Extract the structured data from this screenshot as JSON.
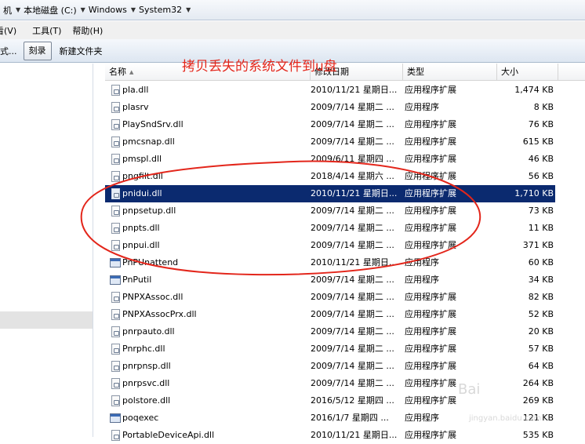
{
  "address": {
    "crumbs": [
      "机",
      "本地磁盘 (C:)",
      "Windows",
      "System32"
    ]
  },
  "menubar": {
    "items": [
      "看(V)",
      "工具(T)",
      "帮助(H)"
    ]
  },
  "toolbar": {
    "partial": "式...",
    "burn": "刻录",
    "new_folder": "新建文件夹"
  },
  "annotation": {
    "text": "拷贝丢失的系统文件到u盘",
    "color": "#e3261b"
  },
  "columns": {
    "name": "名称",
    "date": "修改日期",
    "type": "类型",
    "size": "大小"
  },
  "files": [
    {
      "name": "pla.dll",
      "date": "2010/11/21 星期日...",
      "type": "应用程序扩展",
      "size": "1,474 KB",
      "icon": "dll-file-icon"
    },
    {
      "name": "plasrv",
      "date": "2009/7/14 星期二 ...",
      "type": "应用程序",
      "size": "8 KB",
      "icon": "dll-file-icon"
    },
    {
      "name": "PlaySndSrv.dll",
      "date": "2009/7/14 星期二 ...",
      "type": "应用程序扩展",
      "size": "76 KB",
      "icon": "dll-file-icon"
    },
    {
      "name": "pmcsnap.dll",
      "date": "2009/7/14 星期二 ...",
      "type": "应用程序扩展",
      "size": "615 KB",
      "icon": "dll-file-icon"
    },
    {
      "name": "pmspl.dll",
      "date": "2009/6/11 星期四 ...",
      "type": "应用程序扩展",
      "size": "46 KB",
      "icon": "dll-file-icon"
    },
    {
      "name": "pngfilt.dll",
      "date": "2018/4/14 星期六 ...",
      "type": "应用程序扩展",
      "size": "56 KB",
      "icon": "dll-file-icon"
    },
    {
      "name": "pnidui.dll",
      "date": "2010/11/21 星期日...",
      "type": "应用程序扩展",
      "size": "1,710 KB",
      "icon": "dll-file-icon",
      "selected": true
    },
    {
      "name": "pnpsetup.dll",
      "date": "2009/7/14 星期二 ...",
      "type": "应用程序扩展",
      "size": "73 KB",
      "icon": "dll-file-icon"
    },
    {
      "name": "pnpts.dll",
      "date": "2009/7/14 星期二 ...",
      "type": "应用程序扩展",
      "size": "11 KB",
      "icon": "dll-file-icon"
    },
    {
      "name": "pnpui.dll",
      "date": "2009/7/14 星期二 ...",
      "type": "应用程序扩展",
      "size": "371 KB",
      "icon": "dll-file-icon"
    },
    {
      "name": "PnPUnattend",
      "date": "2010/11/21 星期日...",
      "type": "应用程序",
      "size": "60 KB",
      "icon": "exe-file-icon"
    },
    {
      "name": "PnPutil",
      "date": "2009/7/14 星期二 ...",
      "type": "应用程序",
      "size": "34 KB",
      "icon": "exe-file-icon"
    },
    {
      "name": "PNPXAssoc.dll",
      "date": "2009/7/14 星期二 ...",
      "type": "应用程序扩展",
      "size": "82 KB",
      "icon": "dll-file-icon"
    },
    {
      "name": "PNPXAssocPrx.dll",
      "date": "2009/7/14 星期二 ...",
      "type": "应用程序扩展",
      "size": "52 KB",
      "icon": "dll-file-icon"
    },
    {
      "name": "pnrpauto.dll",
      "date": "2009/7/14 星期二 ...",
      "type": "应用程序扩展",
      "size": "20 KB",
      "icon": "dll-file-icon"
    },
    {
      "name": "Pnrphc.dll",
      "date": "2009/7/14 星期二 ...",
      "type": "应用程序扩展",
      "size": "57 KB",
      "icon": "dll-file-icon"
    },
    {
      "name": "pnrpnsp.dll",
      "date": "2009/7/14 星期二 ...",
      "type": "应用程序扩展",
      "size": "64 KB",
      "icon": "dll-file-icon"
    },
    {
      "name": "pnrpsvc.dll",
      "date": "2009/7/14 星期二 ...",
      "type": "应用程序扩展",
      "size": "264 KB",
      "icon": "dll-file-icon"
    },
    {
      "name": "polstore.dll",
      "date": "2016/5/12 星期四 ...",
      "type": "应用程序扩展",
      "size": "269 KB",
      "icon": "dll-file-icon"
    },
    {
      "name": "poqexec",
      "date": "2016/1/7 星期四 ...",
      "type": "应用程序",
      "size": "121 KB",
      "icon": "exe-file-icon"
    },
    {
      "name": "PortableDeviceApi.dll",
      "date": "2010/11/21 星期日...",
      "type": "应用程序扩展",
      "size": "535 KB",
      "icon": "dll-file-icon"
    }
  ],
  "watermark": {
    "text": "Bai",
    "url": "jingyan.baidu.com"
  }
}
